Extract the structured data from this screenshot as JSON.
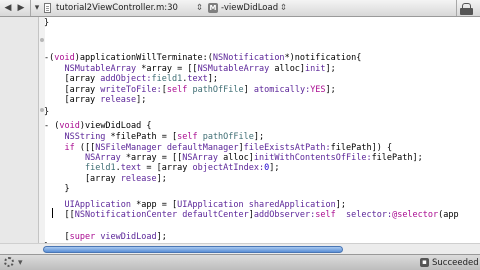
{
  "jump_bar": {
    "file_name": "tutorial2ViewController.m:30",
    "method_name": "-viewDidLoad"
  },
  "editor": {
    "lines": [
      {
        "id": "l1",
        "segments": [
          {
            "t": "}",
            "c": "braces"
          }
        ]
      },
      {
        "id": "l2",
        "segments": []
      },
      {
        "id": "l3",
        "segments": [
          {
            "t": "-(",
            "c": ""
          },
          {
            "t": "void",
            "c": "kw"
          },
          {
            "t": ")applicationWillTerminate:(",
            "c": ""
          },
          {
            "t": "NSNotification",
            "c": "cls"
          },
          {
            "t": "*)notification{",
            "c": ""
          }
        ]
      },
      {
        "id": "l4",
        "segments": [
          {
            "t": "    ",
            "c": ""
          },
          {
            "t": "NSMutableArray",
            "c": "cls"
          },
          {
            "t": " *array = [[",
            "c": ""
          },
          {
            "t": "NSMutableArray",
            "c": "cls"
          },
          {
            "t": " alloc]",
            "c": ""
          },
          {
            "t": "init",
            "c": "cls"
          },
          {
            "t": "];",
            "c": ""
          }
        ]
      },
      {
        "id": "l5",
        "segments": [
          {
            "t": "    [array ",
            "c": ""
          },
          {
            "t": "addObject:",
            "c": "cls"
          },
          {
            "t": "field1",
            "c": "proj"
          },
          {
            "t": ".",
            "c": ""
          },
          {
            "t": "text",
            "c": "cls"
          },
          {
            "t": "];",
            "c": ""
          }
        ]
      },
      {
        "id": "l6",
        "segments": [
          {
            "t": "    [array ",
            "c": ""
          },
          {
            "t": "writeToFile:",
            "c": "cls"
          },
          {
            "t": "[",
            "c": ""
          },
          {
            "t": "self",
            "c": "kw"
          },
          {
            "t": " ",
            "c": ""
          },
          {
            "t": "pathOfFile",
            "c": "proj"
          },
          {
            "t": "] ",
            "c": ""
          },
          {
            "t": "atomically:",
            "c": "cls"
          },
          {
            "t": "YES",
            "c": "kw"
          },
          {
            "t": "];",
            "c": ""
          }
        ]
      },
      {
        "id": "l7",
        "segments": [
          {
            "t": "    [array ",
            "c": ""
          },
          {
            "t": "release",
            "c": "cls"
          },
          {
            "t": "];",
            "c": ""
          }
        ]
      },
      {
        "id": "l8",
        "segments": [
          {
            "t": "}",
            "c": ""
          }
        ]
      },
      {
        "id": "l9",
        "segments": []
      },
      {
        "id": "l10",
        "segments": [
          {
            "t": "- (",
            "c": ""
          },
          {
            "t": "void",
            "c": "kw"
          },
          {
            "t": ")viewDidLoad {",
            "c": ""
          }
        ]
      },
      {
        "id": "l11",
        "segments": [
          {
            "t": "    ",
            "c": ""
          },
          {
            "t": "NSString",
            "c": "cls"
          },
          {
            "t": " *filePath = [",
            "c": ""
          },
          {
            "t": "self",
            "c": "kw"
          },
          {
            "t": " ",
            "c": ""
          },
          {
            "t": "pathOfFile",
            "c": "proj"
          },
          {
            "t": "];",
            "c": ""
          }
        ]
      },
      {
        "id": "l12",
        "segments": [
          {
            "t": "    ",
            "c": ""
          },
          {
            "t": "if",
            "c": "kw"
          },
          {
            "t": " ([[",
            "c": ""
          },
          {
            "t": "NSFileManager",
            "c": "cls"
          },
          {
            "t": " ",
            "c": ""
          },
          {
            "t": "defaultManager",
            "c": "cls"
          },
          {
            "t": "]",
            "c": ""
          },
          {
            "t": "fileExistsAtPath:",
            "c": "cls"
          },
          {
            "t": "filePath]) {",
            "c": ""
          }
        ]
      },
      {
        "id": "l13",
        "segments": [
          {
            "t": "        ",
            "c": ""
          },
          {
            "t": "NSArray",
            "c": "cls"
          },
          {
            "t": " *array = [[",
            "c": ""
          },
          {
            "t": "NSArray",
            "c": "cls"
          },
          {
            "t": " alloc]",
            "c": ""
          },
          {
            "t": "initWithContentsOfFile:",
            "c": "cls"
          },
          {
            "t": "filePath];",
            "c": ""
          }
        ]
      },
      {
        "id": "l14",
        "segments": [
          {
            "t": "        ",
            "c": ""
          },
          {
            "t": "field1",
            "c": "proj"
          },
          {
            "t": ".",
            "c": ""
          },
          {
            "t": "text",
            "c": "cls"
          },
          {
            "t": " = [array ",
            "c": ""
          },
          {
            "t": "objectAtIndex:",
            "c": "cls"
          },
          {
            "t": "0",
            "c": "num"
          },
          {
            "t": "];",
            "c": ""
          }
        ]
      },
      {
        "id": "l15",
        "segments": [
          {
            "t": "        [array ",
            "c": ""
          },
          {
            "t": "release",
            "c": "cls"
          },
          {
            "t": "];",
            "c": ""
          }
        ]
      },
      {
        "id": "l16",
        "segments": [
          {
            "t": "    }",
            "c": ""
          }
        ]
      },
      {
        "id": "l17",
        "segments": []
      },
      {
        "id": "l18",
        "segments": [
          {
            "t": "    ",
            "c": ""
          },
          {
            "t": "UIApplication",
            "c": "cls"
          },
          {
            "t": " *app = [",
            "c": ""
          },
          {
            "t": "UIApplication",
            "c": "cls"
          },
          {
            "t": " ",
            "c": ""
          },
          {
            "t": "sharedApplication",
            "c": "cls"
          },
          {
            "t": "];",
            "c": ""
          }
        ]
      },
      {
        "id": "l19",
        "segments": [
          {
            "t": "    [[",
            "c": ""
          },
          {
            "t": "NSNotificationCenter",
            "c": "cls"
          },
          {
            "t": " ",
            "c": ""
          },
          {
            "t": "defaultCenter",
            "c": "cls"
          },
          {
            "t": "]",
            "c": ""
          },
          {
            "t": "addObserver:",
            "c": "cls"
          },
          {
            "t": "self",
            "c": "kw"
          },
          {
            "t": "  ",
            "c": ""
          },
          {
            "t": "selector:",
            "c": "cls"
          },
          {
            "t": "@selector",
            "c": "kw"
          },
          {
            "t": "(app",
            "c": ""
          }
        ]
      },
      {
        "id": "l20",
        "segments": []
      },
      {
        "id": "l21",
        "segments": [
          {
            "t": "    [",
            "c": ""
          },
          {
            "t": "super",
            "c": "kw"
          },
          {
            "t": " ",
            "c": ""
          },
          {
            "t": "viewDidLoad",
            "c": "cls"
          },
          {
            "t": "];",
            "c": ""
          }
        ]
      },
      {
        "id": "l22",
        "segments": [
          {
            "t": "}",
            "c": ""
          }
        ]
      }
    ]
  },
  "status_bar": {
    "build_status": "Succeeded"
  }
}
